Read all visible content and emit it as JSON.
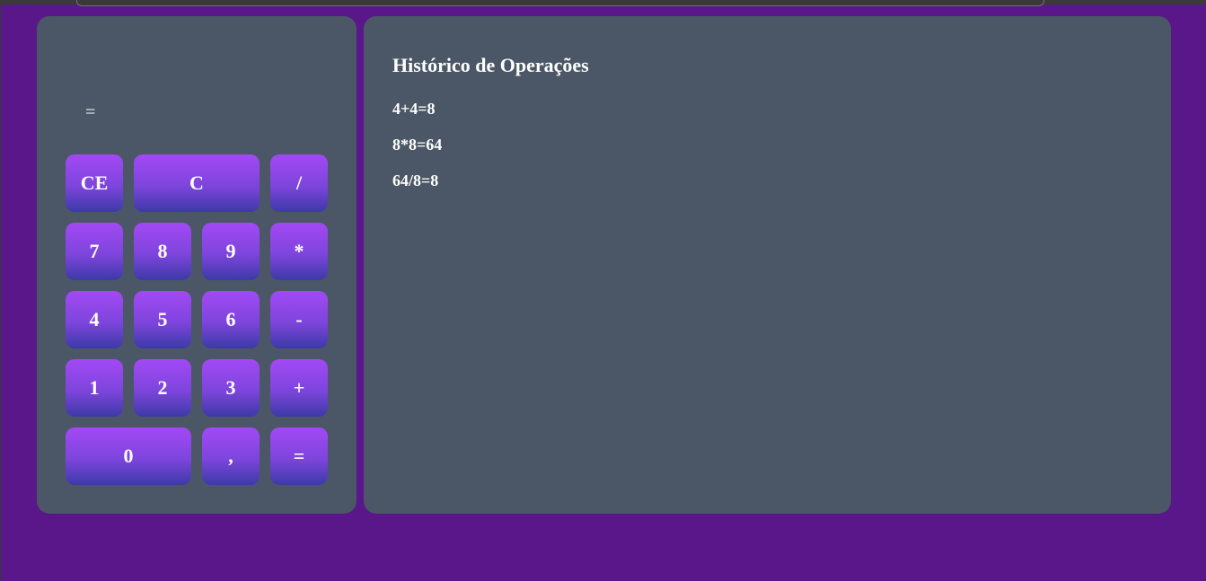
{
  "calculator": {
    "display": "=",
    "buttons": {
      "ce": "CE",
      "c": "C",
      "divide": "/",
      "seven": "7",
      "eight": "8",
      "nine": "9",
      "multiply": "*",
      "four": "4",
      "five": "5",
      "six": "6",
      "minus": "-",
      "one": "1",
      "two": "2",
      "three": "3",
      "plus": "+",
      "zero": "0",
      "comma": ",",
      "equals": "="
    }
  },
  "history": {
    "title": "Histórico de Operações",
    "items": [
      "4+4=8",
      "8*8=64",
      "64/8=8"
    ]
  },
  "colors": {
    "page_background": "#5a178a",
    "panel_background": "#4b5766",
    "button_gradient_top": "#a349f5",
    "button_gradient_bottom": "#3c3aa7",
    "text": "#ffffff"
  }
}
